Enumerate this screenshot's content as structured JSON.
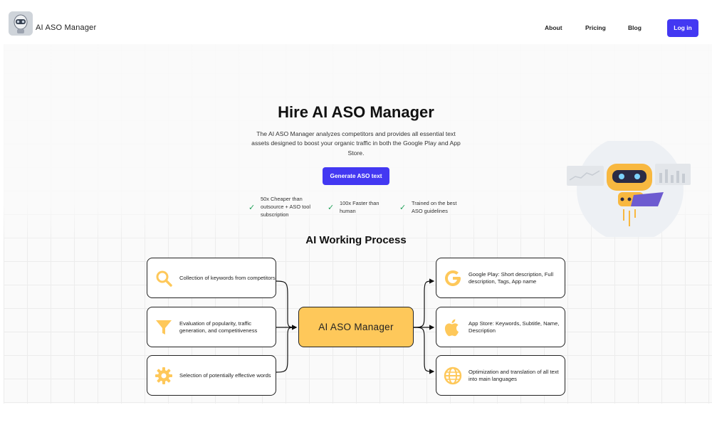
{
  "header": {
    "app_name": "AI ASO Manager",
    "nav": [
      "About",
      "Pricing",
      "Blog"
    ],
    "login_label": "Log in"
  },
  "hero": {
    "title": "Hire AI ASO Manager",
    "subtitle": "The AI ASO Manager analyzes competitors and provides all essential text assets designed to boost your organic traffic in both the Google Play and App Store.",
    "cta_label": "Generate ASO text",
    "features": [
      "50x Cheaper than outsource + ASO tool subscription",
      "100x Faster than human",
      "Trained on the best ASO guidelines"
    ]
  },
  "process": {
    "title": "AI Working Process",
    "center_label": "AI ASO Manager",
    "inputs": [
      {
        "icon": "search-icon",
        "text": "Collection of keywords from competitors"
      },
      {
        "icon": "funnel-icon",
        "text": "Evaluation of popularity, traffic generation, and competitiveness"
      },
      {
        "icon": "gear-icon",
        "text": "Selection of potentially effective words"
      }
    ],
    "outputs": [
      {
        "icon": "google-icon",
        "text": "Google Play: Short description, Full description, Tags, App name"
      },
      {
        "icon": "apple-icon",
        "text": "App Store: Keywords, Subtitle, Name, Description"
      },
      {
        "icon": "globe-icon",
        "text": "Optimization and translation of all text into main languages"
      }
    ]
  },
  "colors": {
    "accent": "#4338f2",
    "icon_yellow": "#fec85a",
    "check_green": "#22a35a"
  }
}
